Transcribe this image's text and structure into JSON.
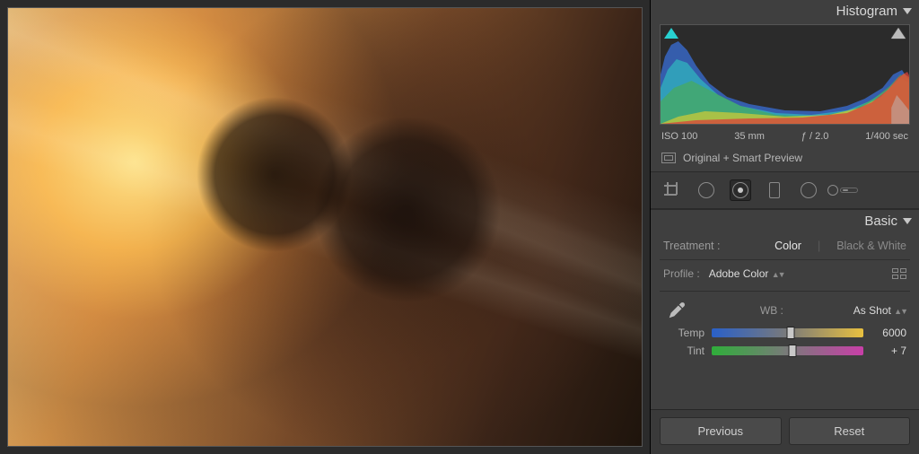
{
  "panels": {
    "histogram": {
      "title": "Histogram"
    },
    "basic": {
      "title": "Basic"
    }
  },
  "histogram": {
    "meta": {
      "iso": "ISO 100",
      "focal_length": "35 mm",
      "aperture": "ƒ / 2.0",
      "shutter": "1/400 sec"
    },
    "preview_mode": "Original + Smart Preview",
    "clipping": {
      "shadows": true,
      "highlights": true
    }
  },
  "tools": {
    "crop": "crop-tool",
    "spot": "spot-removal-tool",
    "redeye": "redeye-tool",
    "graduated": "graduated-filter-tool",
    "radial": "radial-filter-tool",
    "adjust": "adjustment-brush-tool",
    "selected": "redeye"
  },
  "basic": {
    "treatment_label": "Treatment :",
    "treatment_options": {
      "color": "Color",
      "bw": "Black & White"
    },
    "treatment_active": "color",
    "profile_label": "Profile :",
    "profile_value": "Adobe Color",
    "wb_label": "WB :",
    "wb_value": "As Shot",
    "sliders": {
      "temp": {
        "label": "Temp",
        "value": "6000"
      },
      "tint": {
        "label": "Tint",
        "value": "+ 7"
      }
    }
  },
  "buttons": {
    "previous": "Previous",
    "reset": "Reset"
  }
}
